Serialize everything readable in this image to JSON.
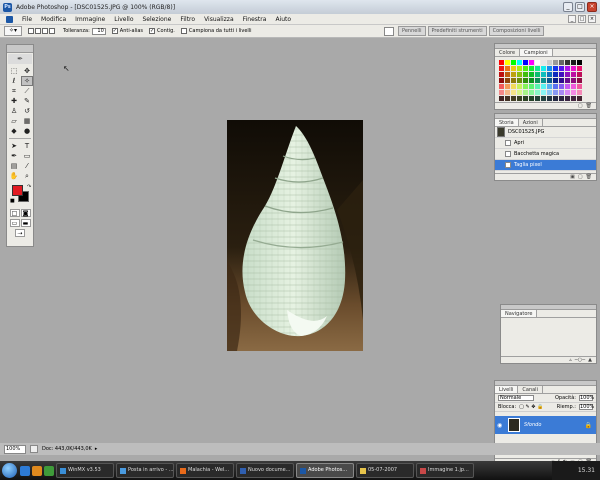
{
  "window": {
    "title": "Adobe Photoshop - [DSC01525.JPG @ 100% (RGB/8)]",
    "app_icon": "Ps"
  },
  "menu": [
    "File",
    "Modifica",
    "Immagine",
    "Livello",
    "Selezione",
    "Filtro",
    "Visualizza",
    "Finestra",
    "Aiuto"
  ],
  "options_bar": {
    "tolleranza_label": "Tolleranza:",
    "tolleranza_value": "10",
    "anti_alias": "Anti-alias",
    "contig": "Contig.",
    "campiona": "Campiona da tutti i livelli",
    "tabs": [
      "Pennelli",
      "Predefiniti strumenti",
      "Composizioni livelli"
    ]
  },
  "panels": {
    "color": {
      "tabs": [
        "Colore",
        "Campioni"
      ]
    },
    "history": {
      "tabs": [
        "Storia",
        "Azioni"
      ],
      "snapshot": "DSC01525.JPG",
      "rows": [
        "Apri",
        "Bacchetta magica",
        "Taglia pixel"
      ]
    },
    "navigator": {
      "tabs": [
        "Navigatore"
      ]
    },
    "layers": {
      "tabs": [
        "Livelli",
        "Canali"
      ],
      "blend_mode": "Normale",
      "opacity_label": "Opacità:",
      "opacity_value": "100%",
      "lock_label": "Blocca:",
      "fill_label": "Riemp.:",
      "fill_value": "100%",
      "layer_name": "Sfondo"
    }
  },
  "status": {
    "zoom": "100%",
    "doc_info": "Doc: 443,0K/443,0K"
  },
  "taskbar": {
    "tasks": [
      "WinMX v3.53",
      "Posta in arrivo - ...",
      "Malachia - Wel...",
      "Nuovo docume...",
      "Adobe Photos...",
      "05-07-2007",
      "Immagine 1.jp..."
    ],
    "active_task": 4,
    "clock": "15.31"
  },
  "colors": {
    "foreground": "#e21a22",
    "background": "#000000",
    "selection": "#3b7bd6"
  }
}
